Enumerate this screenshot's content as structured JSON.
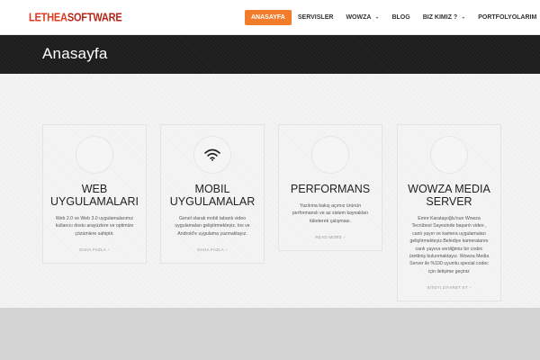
{
  "logo": {
    "left": "LETHEA",
    "right": "SOFTWARE"
  },
  "nav": {
    "items": [
      {
        "label": "ANASAYFA",
        "active": true,
        "dropdown": false
      },
      {
        "label": "SERVISLER",
        "active": false,
        "dropdown": false
      },
      {
        "label": "WOWZA",
        "active": false,
        "dropdown": true
      },
      {
        "label": "BLOG",
        "active": false,
        "dropdown": false
      },
      {
        "label": "BIZ KIMIZ ?",
        "active": false,
        "dropdown": true
      },
      {
        "label": "PORTFOLYOLARIM",
        "active": false,
        "dropdown": true
      }
    ]
  },
  "page": {
    "title": "Anasayfa"
  },
  "cards": [
    {
      "title": "WEB UYGULAMALARI",
      "text": "Web 2.0 ve Web 3.0 uygulamalarımız kullanıcı dostu arayüzlere ve optimize çözümlere sahiptir.",
      "link": "DAHA FAZLA",
      "icon": "none"
    },
    {
      "title": "MOBIL UYGULAMALAR",
      "text": "Genel olarak mobil tabanlı video uygulamaları geliştirmekteyiz. Ios ve Android'e uygulama yazmaktayız.",
      "link": "DAHA FAZLA",
      "icon": "wifi-icon"
    },
    {
      "title": "PERFORMANS",
      "text": "Yazılıma bakış açımız ürünün performanslı ve az sistem kaynakları tüketerek çalışması.",
      "link": "READ MORE",
      "icon": "none"
    },
    {
      "title": "WOWZA MEDIA SERVER",
      "text": "Emre Karataşoğlu'nun Wowza Tecrübesi Sayesinde başarılı video , canlı yayın ve kamera uygulamaları geliştirmekteyiz.Belediye kameralarını canlı yayına verdiğimiz bir codec ürettiniş bulunmaktayız. Wowza Media Server ile %100 uyumlu special codec için iletişime geçiniz",
      "link": "SITEYI ZIYARET ET",
      "icon": "none"
    }
  ],
  "colors": {
    "accent": "#f07c2c",
    "logo": "#e03a1e",
    "titlebar": "#1d1d1d",
    "footer": "#d4d4d4"
  }
}
